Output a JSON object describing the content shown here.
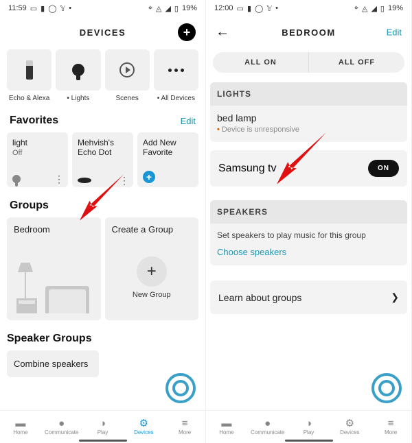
{
  "status": {
    "time_left": "11:59",
    "time_right": "12:00",
    "battery": "19%"
  },
  "left": {
    "title": "DEVICES",
    "categories": [
      {
        "label": "Echo & Alexa",
        "icon": "echo-icon"
      },
      {
        "label": "• Lights",
        "icon": "bulb-icon"
      },
      {
        "label": "Scenes",
        "icon": "scene-icon"
      },
      {
        "label": "• All Devices",
        "icon": "dots-icon"
      }
    ],
    "favorites_title": "Favorites",
    "favorites_edit": "Edit",
    "favorites": [
      {
        "label": "light",
        "sub": "Off"
      },
      {
        "label": "Mehvish's Echo Dot",
        "sub": ""
      },
      {
        "label": "Add New Favorite",
        "sub": ""
      }
    ],
    "groups_title": "Groups",
    "groups": {
      "bedroom_label": "Bedroom",
      "create_label": "Create a Group",
      "new_group_label": "New Group"
    },
    "speaker_groups_title": "Speaker Groups",
    "combine_speakers": "Combine speakers"
  },
  "right": {
    "title": "BEDROOM",
    "edit": "Edit",
    "all_on": "ALL ON",
    "all_off": "ALL OFF",
    "lights_header": "LIGHTS",
    "lights_item_name": "bed lamp",
    "lights_item_warn": "Device is unresponsive",
    "tv_name": "Samsung tv",
    "tv_state": "ON",
    "speakers_header": "SPEAKERS",
    "speakers_body": "Set speakers to play music for this group",
    "speakers_link": "Choose speakers",
    "learn_label": "Learn about groups"
  },
  "nav": {
    "items": [
      {
        "label": "Home"
      },
      {
        "label": "Communicate"
      },
      {
        "label": "Play"
      },
      {
        "label": "Devices"
      },
      {
        "label": "More"
      }
    ]
  }
}
